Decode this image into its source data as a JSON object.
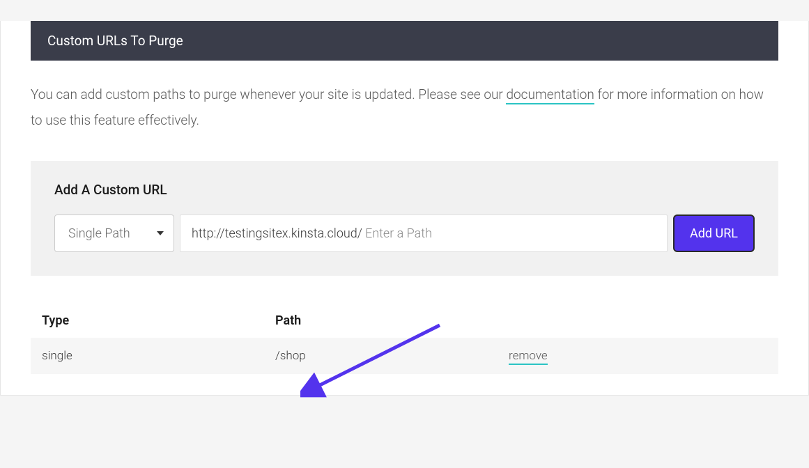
{
  "header": {
    "title": "Custom URLs To Purge"
  },
  "description": {
    "text_before": "You can add custom paths to purge whenever your site is updated. Please see our ",
    "link_text": "documentation",
    "text_after": " for more information on how to use this feature effectively."
  },
  "add_panel": {
    "title": "Add A Custom URL",
    "select_label": "Single Path",
    "url_prefix": "http://testingsitex.kinsta.cloud/",
    "url_placeholder": "Enter a Path",
    "button_label": "Add URL"
  },
  "table": {
    "headers": {
      "type": "Type",
      "path": "Path"
    },
    "rows": [
      {
        "type": "single",
        "path": "/shop",
        "action": "remove"
      }
    ]
  }
}
